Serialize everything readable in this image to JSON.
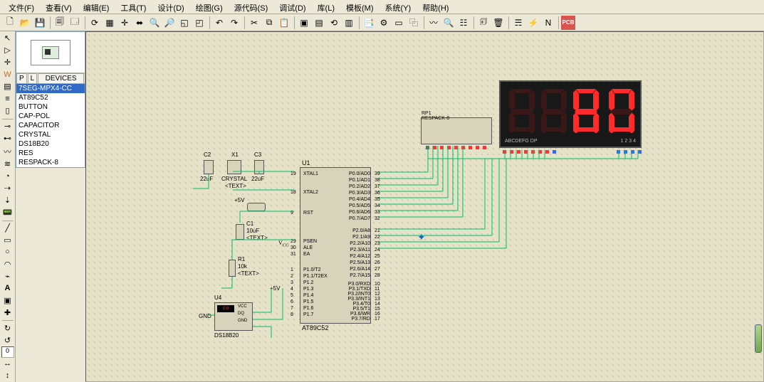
{
  "menu": {
    "file": "文件(F)",
    "view": "查看(V)",
    "edit": "编辑(E)",
    "tool": "工具(T)",
    "design": "设计(D)",
    "graph": "绘图(G)",
    "source": "源代码(S)",
    "debug": "调试(D)",
    "library": "库(L)",
    "template": "模板(M)",
    "system": "系统(Y)",
    "help": "帮助(H)"
  },
  "tabs": {
    "p": "P",
    "l": "L",
    "devices": "DEVICES"
  },
  "components": {
    "items": [
      "7SEG-MPX4-CC",
      "AT89C52",
      "BUTTON",
      "CAP-POL",
      "CAPACITOR",
      "CRYSTAL",
      "DS18B20",
      "RES",
      "RESPACK-8"
    ],
    "selectedIndex": 0
  },
  "spin_value": "0",
  "schematic": {
    "mcu": {
      "ref": "U1",
      "part": "AT89C52",
      "left_pins": [
        {
          "num": "19",
          "name": "XTAL1"
        },
        {
          "num": "18",
          "name": "XTAL2"
        },
        {
          "num": "9",
          "name": "RST"
        },
        {
          "num": "29",
          "name": "PSEN"
        },
        {
          "num": "30",
          "name": "ALE"
        },
        {
          "num": "31",
          "name": "EA"
        },
        {
          "num": "1",
          "name": "P1.0/T2"
        },
        {
          "num": "2",
          "name": "P1.1/T2EX"
        },
        {
          "num": "3",
          "name": "P1.2"
        },
        {
          "num": "4",
          "name": "P1.3"
        },
        {
          "num": "5",
          "name": "P1.4"
        },
        {
          "num": "6",
          "name": "P1.5"
        },
        {
          "num": "7",
          "name": "P1.6"
        },
        {
          "num": "8",
          "name": "P1.7"
        }
      ],
      "right_pins_a": [
        {
          "num": "39",
          "name": "P0.0/AD0"
        },
        {
          "num": "38",
          "name": "P0.1/AD1"
        },
        {
          "num": "37",
          "name": "P0.2/AD2"
        },
        {
          "num": "36",
          "name": "P0.3/AD3"
        },
        {
          "num": "35",
          "name": "P0.4/AD4"
        },
        {
          "num": "34",
          "name": "P0.5/AD5"
        },
        {
          "num": "33",
          "name": "P0.6/AD6"
        },
        {
          "num": "32",
          "name": "P0.7/AD7"
        }
      ],
      "right_pins_b": [
        {
          "num": "21",
          "name": "P2.0/A8"
        },
        {
          "num": "22",
          "name": "P2.1/A9"
        },
        {
          "num": "23",
          "name": "P2.2/A10"
        },
        {
          "num": "24",
          "name": "P2.3/A11"
        },
        {
          "num": "25",
          "name": "P2.4/A12"
        },
        {
          "num": "26",
          "name": "P2.5/A13"
        },
        {
          "num": "27",
          "name": "P2.6/A14"
        },
        {
          "num": "28",
          "name": "P2.7/A15"
        }
      ],
      "right_pins_c": [
        {
          "num": "10",
          "name": "P3.0/RXD"
        },
        {
          "num": "11",
          "name": "P3.1/TXD"
        },
        {
          "num": "12",
          "name": "P3.2/INT0"
        },
        {
          "num": "13",
          "name": "P3.3/INT1"
        },
        {
          "num": "14",
          "name": "P3.4/T0"
        },
        {
          "num": "15",
          "name": "P3.5/T1"
        },
        {
          "num": "16",
          "name": "P3.6/WR"
        },
        {
          "num": "17",
          "name": "P3.7/RD"
        }
      ]
    },
    "respack": {
      "ref": "RP1",
      "part": "RESPACK-8"
    },
    "c1": {
      "ref": "C1",
      "value": "10uF",
      "text": "<TEXT>"
    },
    "c2": {
      "ref": "C2",
      "value": "22uF"
    },
    "c3": {
      "ref": "C3",
      "value": "22uF"
    },
    "x1": {
      "ref": "X1",
      "value": "CRYSTAL",
      "text": "<TEXT>"
    },
    "r1": {
      "ref": "R1",
      "value": "10k",
      "text": "<TEXT>"
    },
    "u4": {
      "ref": "U4",
      "part": "DS18B20",
      "reading": "0.0",
      "pins": [
        "VCC",
        "DQ",
        "GND"
      ]
    },
    "display": {
      "ref": "",
      "footer_left": "ABCDEFG  DP",
      "footer_right": "1 2 3 4"
    },
    "nets": {
      "vcc": "+5V",
      "gnd": "GND"
    },
    "vcc_glyph": "VCC"
  }
}
